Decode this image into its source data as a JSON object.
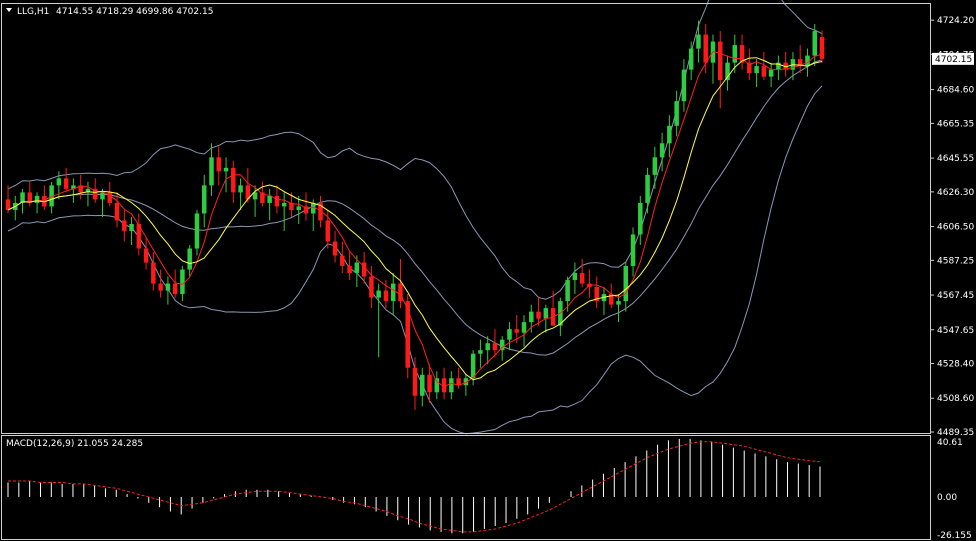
{
  "header": {
    "symbol": "LLG,H1",
    "ohlc": "4714.55 4718.29 4699.86 4702.15"
  },
  "current_price_label": "4702.15",
  "macd_header": "MACD(12,26,9) 21.055 24.285",
  "colors": {
    "background": "#000000",
    "bull": "#2ecc40",
    "bear": "#ff1a1a",
    "ma_fast": "#ff2020",
    "ma_slow": "#ffff40",
    "bands": "#8a96b4",
    "grid_frame": "#ffffff",
    "macd_hist": "#ffffff",
    "macd_signal": "#ff2020"
  },
  "chart_data": [
    {
      "type": "candlestick",
      "title": "LLG,H1",
      "price_axis": {
        "ticks": [
          "4724.20",
          "4704.75",
          "4684.60",
          "4665.35",
          "4645.55",
          "4626.30",
          "4606.50",
          "4587.25",
          "4567.45",
          "4547.65",
          "4528.40",
          "4508.60",
          "4489.35"
        ],
        "ylim": [
          4489.35,
          4734.0
        ]
      },
      "current_price": 4702.15,
      "candles": [
        [
          4622,
          4630,
          4614,
          4616
        ],
        [
          4616,
          4624,
          4610,
          4620
        ],
        [
          4620,
          4628,
          4614,
          4626
        ],
        [
          4626,
          4632,
          4618,
          4620
        ],
        [
          4620,
          4626,
          4614,
          4624
        ],
        [
          4624,
          4630,
          4616,
          4618
        ],
        [
          4618,
          4632,
          4614,
          4630
        ],
        [
          4630,
          4638,
          4622,
          4634
        ],
        [
          4634,
          4640,
          4626,
          4628
        ],
        [
          4628,
          4634,
          4620,
          4630
        ],
        [
          4630,
          4636,
          4622,
          4626
        ],
        [
          4626,
          4632,
          4618,
          4628
        ],
        [
          4628,
          4634,
          4620,
          4622
        ],
        [
          4622,
          4628,
          4612,
          4626
        ],
        [
          4626,
          4632,
          4618,
          4620
        ],
        [
          4620,
          4626,
          4606,
          4610
        ],
        [
          4610,
          4616,
          4598,
          4604
        ],
        [
          4604,
          4612,
          4596,
          4608
        ],
        [
          4608,
          4614,
          4590,
          4594
        ],
        [
          4594,
          4600,
          4582,
          4586
        ],
        [
          4586,
          4592,
          4570,
          4574
        ],
        [
          4574,
          4582,
          4566,
          4570
        ],
        [
          4570,
          4578,
          4562,
          4574
        ],
        [
          4574,
          4582,
          4566,
          4568
        ],
        [
          4568,
          4584,
          4564,
          4582
        ],
        [
          4582,
          4596,
          4578,
          4594
        ],
        [
          4594,
          4616,
          4590,
          4614
        ],
        [
          4614,
          4636,
          4606,
          4630
        ],
        [
          4630,
          4654,
          4624,
          4646
        ],
        [
          4646,
          4652,
          4630,
          4638
        ],
        [
          4638,
          4646,
          4626,
          4640
        ],
        [
          4640,
          4644,
          4620,
          4626
        ],
        [
          4626,
          4634,
          4616,
          4630
        ],
        [
          4630,
          4640,
          4620,
          4622
        ],
        [
          4622,
          4630,
          4612,
          4626
        ],
        [
          4626,
          4632,
          4618,
          4620
        ],
        [
          4620,
          4628,
          4610,
          4624
        ],
        [
          4624,
          4630,
          4614,
          4618
        ],
        [
          4618,
          4626,
          4604,
          4620
        ],
        [
          4620,
          4626,
          4612,
          4616
        ],
        [
          4616,
          4624,
          4608,
          4618
        ],
        [
          4618,
          4626,
          4610,
          4614
        ],
        [
          4614,
          4622,
          4604,
          4620
        ],
        [
          4620,
          4624,
          4606,
          4610
        ],
        [
          4610,
          4616,
          4594,
          4598
        ],
        [
          4598,
          4604,
          4586,
          4590
        ],
        [
          4590,
          4598,
          4580,
          4584
        ],
        [
          4584,
          4592,
          4576,
          4580
        ],
        [
          4580,
          4590,
          4572,
          4586
        ],
        [
          4586,
          4592,
          4574,
          4578
        ],
        [
          4578,
          4584,
          4560,
          4566
        ],
        [
          4566,
          4574,
          4532,
          4570
        ],
        [
          4570,
          4576,
          4560,
          4564
        ],
        [
          4564,
          4580,
          4556,
          4574
        ],
        [
          4574,
          4588,
          4560,
          4564
        ],
        [
          4564,
          4568,
          4520,
          4526
        ],
        [
          4526,
          4532,
          4502,
          4510
        ],
        [
          4510,
          4526,
          4504,
          4522
        ],
        [
          4522,
          4528,
          4506,
          4512
        ],
        [
          4512,
          4524,
          4508,
          4520
        ],
        [
          4520,
          4526,
          4508,
          4512
        ],
        [
          4512,
          4524,
          4508,
          4520
        ],
        [
          4520,
          4526,
          4514,
          4516
        ],
        [
          4516,
          4522,
          4510,
          4520
        ],
        [
          4520,
          4536,
          4516,
          4534
        ],
        [
          4534,
          4542,
          4526,
          4536
        ],
        [
          4536,
          4544,
          4528,
          4540
        ],
        [
          4540,
          4548,
          4532,
          4536
        ],
        [
          4536,
          4544,
          4530,
          4542
        ],
        [
          4542,
          4552,
          4536,
          4548
        ],
        [
          4548,
          4556,
          4540,
          4546
        ],
        [
          4546,
          4556,
          4538,
          4552
        ],
        [
          4552,
          4562,
          4546,
          4558
        ],
        [
          4558,
          4566,
          4550,
          4554
        ],
        [
          4554,
          4562,
          4546,
          4560
        ],
        [
          4560,
          4570,
          4552,
          4550
        ],
        [
          4550,
          4566,
          4544,
          4564
        ],
        [
          4564,
          4578,
          4558,
          4576
        ],
        [
          4576,
          4586,
          4568,
          4580
        ],
        [
          4580,
          4588,
          4572,
          4574
        ],
        [
          4574,
          4582,
          4566,
          4572
        ],
        [
          4572,
          4578,
          4560,
          4564
        ],
        [
          4564,
          4572,
          4556,
          4568
        ],
        [
          4568,
          4574,
          4560,
          4562
        ],
        [
          4562,
          4568,
          4552,
          4564
        ],
        [
          4564,
          4586,
          4558,
          4584
        ],
        [
          4584,
          4606,
          4578,
          4602
        ],
        [
          4602,
          4624,
          4596,
          4620
        ],
        [
          4620,
          4640,
          4614,
          4636
        ],
        [
          4636,
          4652,
          4628,
          4646
        ],
        [
          4646,
          4660,
          4638,
          4654
        ],
        [
          4654,
          4670,
          4646,
          4664
        ],
        [
          4664,
          4684,
          4658,
          4678
        ],
        [
          4678,
          4702,
          4672,
          4696
        ],
        [
          4696,
          4712,
          4690,
          4708
        ],
        [
          4708,
          4724,
          4700,
          4716
        ],
        [
          4716,
          4722,
          4694,
          4700
        ],
        [
          4700,
          4716,
          4688,
          4712
        ],
        [
          4712,
          4718,
          4674,
          4690
        ],
        [
          4690,
          4704,
          4684,
          4700
        ],
        [
          4700,
          4716,
          4694,
          4710
        ],
        [
          4710,
          4716,
          4696,
          4700
        ],
        [
          4700,
          4708,
          4690,
          4694
        ],
        [
          4694,
          4702,
          4686,
          4698
        ],
        [
          4698,
          4706,
          4690,
          4692
        ],
        [
          4692,
          4700,
          4686,
          4696
        ],
        [
          4696,
          4704,
          4690,
          4700
        ],
        [
          4700,
          4706,
          4692,
          4696
        ],
        [
          4696,
          4706,
          4690,
          4702
        ],
        [
          4702,
          4710,
          4694,
          4698
        ],
        [
          4698,
          4708,
          4692,
          4704
        ],
        [
          4704,
          4722,
          4698,
          4718
        ],
        [
          4714.55,
          4718.29,
          4699.86,
          4702.15
        ]
      ]
    },
    {
      "type": "bar",
      "title": "MACD(12,26,9) 21.055 24.285",
      "axis": {
        "ticks": [
          "40.61",
          "0.00",
          "-26.155"
        ],
        "ylim": [
          -26.155,
          40.61
        ]
      },
      "histogram": [
        10,
        10,
        11,
        10,
        10,
        9,
        9,
        9,
        8,
        6,
        5,
        2,
        -1,
        -4,
        -7,
        -10,
        -12,
        -8,
        -4,
        -1,
        2,
        4,
        5,
        5,
        5,
        4,
        3,
        2,
        1,
        0,
        -2,
        -4,
        -5,
        -7,
        -10,
        -13,
        -16,
        -19,
        -21,
        -23,
        -24,
        -25,
        -25,
        -24,
        -22,
        -20,
        -18,
        -15,
        -12,
        -8,
        -4,
        0,
        4,
        8,
        12,
        16,
        20,
        24,
        28,
        32,
        36,
        39,
        40,
        40,
        39,
        38,
        36,
        34,
        32,
        30,
        28,
        26,
        24,
        23,
        22,
        21
      ],
      "signal": [
        11,
        11,
        11,
        10,
        10,
        10,
        9,
        9,
        8,
        7,
        6,
        4,
        2,
        0,
        -2,
        -4,
        -6,
        -5,
        -4,
        -2,
        0,
        2,
        3,
        4,
        4,
        4,
        3,
        2,
        1,
        0,
        -1,
        -3,
        -4,
        -6,
        -8,
        -10,
        -13,
        -15,
        -18,
        -20,
        -22,
        -23,
        -24,
        -24,
        -23,
        -22,
        -20,
        -18,
        -15,
        -12,
        -9,
        -5,
        -1,
        3,
        7,
        11,
        15,
        19,
        23,
        27,
        30,
        33,
        35,
        37,
        38,
        38,
        37,
        36,
        35,
        33,
        31,
        29,
        27,
        26,
        25,
        24.285
      ]
    }
  ]
}
